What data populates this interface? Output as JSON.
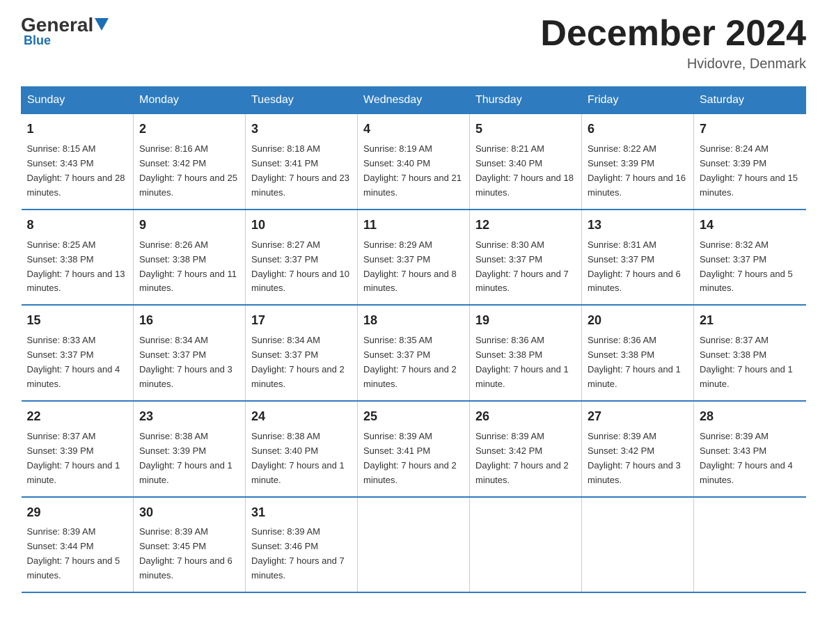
{
  "logo": {
    "general": "General",
    "blue": "Blue",
    "subtitle": "Blue"
  },
  "header": {
    "month_year": "December 2024",
    "location": "Hvidovre, Denmark"
  },
  "days_of_week": [
    "Sunday",
    "Monday",
    "Tuesday",
    "Wednesday",
    "Thursday",
    "Friday",
    "Saturday"
  ],
  "weeks": [
    [
      {
        "day": "1",
        "sunrise": "8:15 AM",
        "sunset": "3:43 PM",
        "daylight": "7 hours and 28 minutes."
      },
      {
        "day": "2",
        "sunrise": "8:16 AM",
        "sunset": "3:42 PM",
        "daylight": "7 hours and 25 minutes."
      },
      {
        "day": "3",
        "sunrise": "8:18 AM",
        "sunset": "3:41 PM",
        "daylight": "7 hours and 23 minutes."
      },
      {
        "day": "4",
        "sunrise": "8:19 AM",
        "sunset": "3:40 PM",
        "daylight": "7 hours and 21 minutes."
      },
      {
        "day": "5",
        "sunrise": "8:21 AM",
        "sunset": "3:40 PM",
        "daylight": "7 hours and 18 minutes."
      },
      {
        "day": "6",
        "sunrise": "8:22 AM",
        "sunset": "3:39 PM",
        "daylight": "7 hours and 16 minutes."
      },
      {
        "day": "7",
        "sunrise": "8:24 AM",
        "sunset": "3:39 PM",
        "daylight": "7 hours and 15 minutes."
      }
    ],
    [
      {
        "day": "8",
        "sunrise": "8:25 AM",
        "sunset": "3:38 PM",
        "daylight": "7 hours and 13 minutes."
      },
      {
        "day": "9",
        "sunrise": "8:26 AM",
        "sunset": "3:38 PM",
        "daylight": "7 hours and 11 minutes."
      },
      {
        "day": "10",
        "sunrise": "8:27 AM",
        "sunset": "3:37 PM",
        "daylight": "7 hours and 10 minutes."
      },
      {
        "day": "11",
        "sunrise": "8:29 AM",
        "sunset": "3:37 PM",
        "daylight": "7 hours and 8 minutes."
      },
      {
        "day": "12",
        "sunrise": "8:30 AM",
        "sunset": "3:37 PM",
        "daylight": "7 hours and 7 minutes."
      },
      {
        "day": "13",
        "sunrise": "8:31 AM",
        "sunset": "3:37 PM",
        "daylight": "7 hours and 6 minutes."
      },
      {
        "day": "14",
        "sunrise": "8:32 AM",
        "sunset": "3:37 PM",
        "daylight": "7 hours and 5 minutes."
      }
    ],
    [
      {
        "day": "15",
        "sunrise": "8:33 AM",
        "sunset": "3:37 PM",
        "daylight": "7 hours and 4 minutes."
      },
      {
        "day": "16",
        "sunrise": "8:34 AM",
        "sunset": "3:37 PM",
        "daylight": "7 hours and 3 minutes."
      },
      {
        "day": "17",
        "sunrise": "8:34 AM",
        "sunset": "3:37 PM",
        "daylight": "7 hours and 2 minutes."
      },
      {
        "day": "18",
        "sunrise": "8:35 AM",
        "sunset": "3:37 PM",
        "daylight": "7 hours and 2 minutes."
      },
      {
        "day": "19",
        "sunrise": "8:36 AM",
        "sunset": "3:38 PM",
        "daylight": "7 hours and 1 minute."
      },
      {
        "day": "20",
        "sunrise": "8:36 AM",
        "sunset": "3:38 PM",
        "daylight": "7 hours and 1 minute."
      },
      {
        "day": "21",
        "sunrise": "8:37 AM",
        "sunset": "3:38 PM",
        "daylight": "7 hours and 1 minute."
      }
    ],
    [
      {
        "day": "22",
        "sunrise": "8:37 AM",
        "sunset": "3:39 PM",
        "daylight": "7 hours and 1 minute."
      },
      {
        "day": "23",
        "sunrise": "8:38 AM",
        "sunset": "3:39 PM",
        "daylight": "7 hours and 1 minute."
      },
      {
        "day": "24",
        "sunrise": "8:38 AM",
        "sunset": "3:40 PM",
        "daylight": "7 hours and 1 minute."
      },
      {
        "day": "25",
        "sunrise": "8:39 AM",
        "sunset": "3:41 PM",
        "daylight": "7 hours and 2 minutes."
      },
      {
        "day": "26",
        "sunrise": "8:39 AM",
        "sunset": "3:42 PM",
        "daylight": "7 hours and 2 minutes."
      },
      {
        "day": "27",
        "sunrise": "8:39 AM",
        "sunset": "3:42 PM",
        "daylight": "7 hours and 3 minutes."
      },
      {
        "day": "28",
        "sunrise": "8:39 AM",
        "sunset": "3:43 PM",
        "daylight": "7 hours and 4 minutes."
      }
    ],
    [
      {
        "day": "29",
        "sunrise": "8:39 AM",
        "sunset": "3:44 PM",
        "daylight": "7 hours and 5 minutes."
      },
      {
        "day": "30",
        "sunrise": "8:39 AM",
        "sunset": "3:45 PM",
        "daylight": "7 hours and 6 minutes."
      },
      {
        "day": "31",
        "sunrise": "8:39 AM",
        "sunset": "3:46 PM",
        "daylight": "7 hours and 7 minutes."
      },
      null,
      null,
      null,
      null
    ]
  ]
}
